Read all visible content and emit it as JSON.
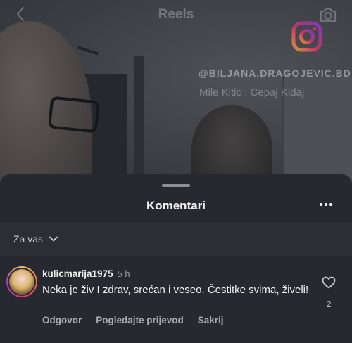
{
  "video": {
    "header_title": "Reels",
    "watermark_handle": "@BILJANA.DRAGOJEVIC.BD",
    "watermark_song": "Mile Kitic : Cepaj Kidaj"
  },
  "sheet": {
    "title": "Komentari",
    "filter_label": "Za vas"
  },
  "comment": {
    "username": "kulicmarija1975",
    "time": "5 h",
    "text": "Neka je živ I zdrav, srećan i veseo. Čestitke svima, živeli!",
    "like_count": "2",
    "actions": {
      "reply": "Odgovor",
      "translate": "Pogledajte prijevod",
      "hide": "Sakrij"
    }
  },
  "icons": {
    "back": "chevron-left-icon",
    "camera": "camera-icon",
    "logo": "instagram-logo-icon",
    "more": "more-horizontal-icon",
    "dropdown": "chevron-down-icon",
    "like": "heart-icon"
  },
  "colors": {
    "sheet_background": "#262a30",
    "filter_background": "#2b2f35",
    "secondary_text": "#a9adb2"
  }
}
